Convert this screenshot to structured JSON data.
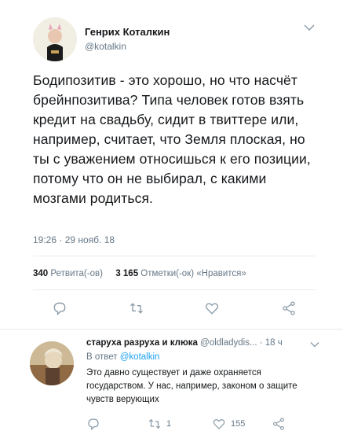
{
  "tweet": {
    "author_name": "Генрих Коталкин",
    "author_handle": "@kotalkin",
    "text": "Бодипозитив - это хорошо, но что насчёт брейнпозитива? Типа человек готов взять кредит на свадьбу, сидит в твиттере или, например, считает, что Земля плоская, но ты с уважением относишься к его позиции, потому что он не выбирал, с какими мозгами родиться.",
    "timestamp": "19:26 · 29 нояб. 18",
    "retweets_count": "340",
    "retweets_label": "Ретвита(-ов)",
    "likes_count": "3 165",
    "likes_label": "Отметки(-ок) «Нравится»"
  },
  "reply": {
    "author_name": "старуха разруха и клюка",
    "author_handle": "@oldladydis...",
    "time": "· 18 ч",
    "reply_to_prefix": "В ответ",
    "reply_to_handle": "@kotalkin",
    "text": "Это давно существует и даже охраняется государством. У нас, например, законом о защите чувств верующих",
    "retweet_count": "1",
    "like_count": "155"
  },
  "colors": {
    "text": "#14171a",
    "muted": "#657786",
    "link": "#1da1f2",
    "separator": "#e6ecf0"
  }
}
